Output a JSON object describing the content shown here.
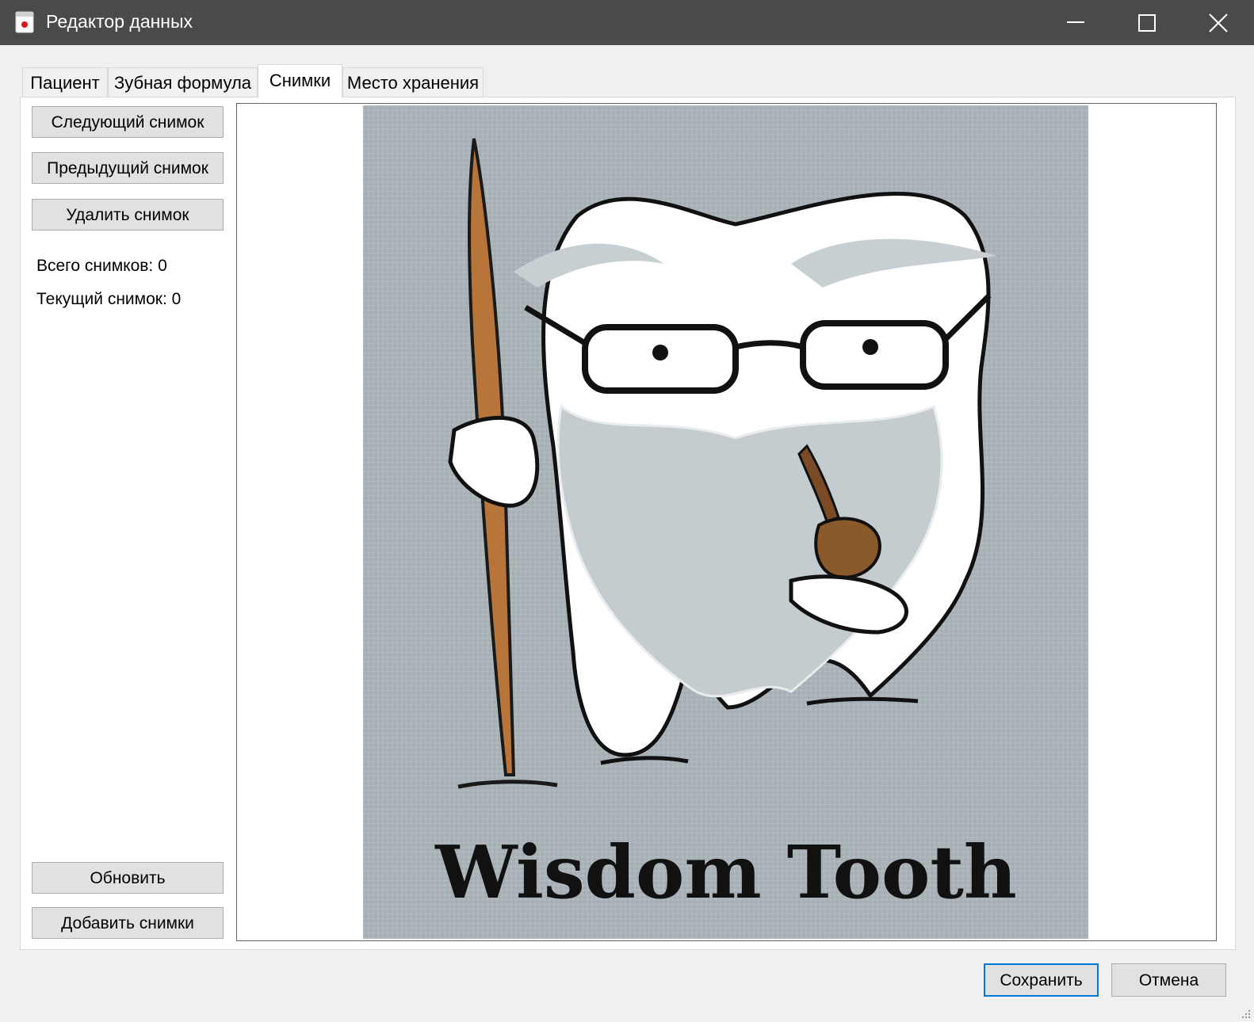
{
  "window": {
    "title": "Редактор данных",
    "icon": "app-icon"
  },
  "titlebar_controls": [
    "minimize-icon",
    "maximize-icon",
    "close-icon"
  ],
  "tabs": [
    {
      "label": "Пациент",
      "active": false
    },
    {
      "label": "Зубная формула",
      "active": false
    },
    {
      "label": "Снимки",
      "active": true
    },
    {
      "label": "Место хранения",
      "active": false
    }
  ],
  "sidebar": {
    "next_label": "Следующий снимок",
    "prev_label": "Предыдущий снимок",
    "delete_label": "Удалить снимок",
    "total_text": "Всего снимков: 0",
    "current_text": "Текущий снимок: 0",
    "refresh_label": "Обновить",
    "add_label": "Добавить снимки"
  },
  "image": {
    "caption": "Wisdom Tooth",
    "background_color": "#aab3b7"
  },
  "footer": {
    "save_label": "Сохранить",
    "cancel_label": "Отмена"
  },
  "colors": {
    "titlebar": "#4a4a4a",
    "accent": "#0078d7"
  }
}
